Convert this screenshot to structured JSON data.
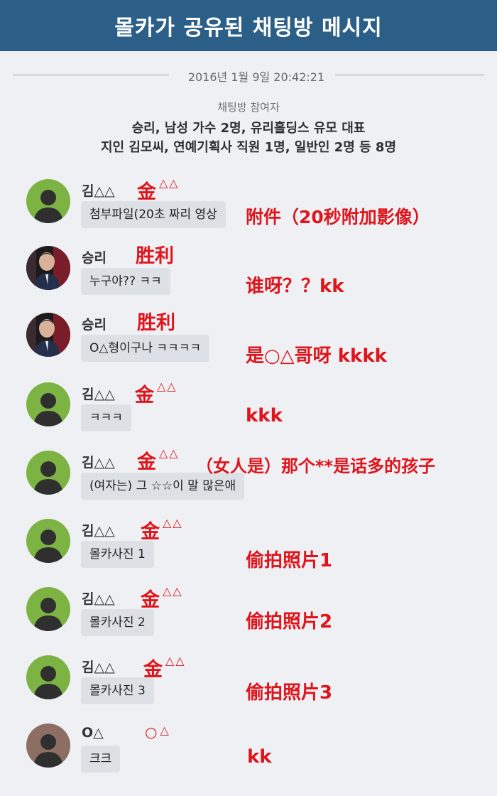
{
  "header": {
    "title": "몰카가 공유된 채팅방 메시지"
  },
  "timestamp": "2016년 1월 9일 20:42:21",
  "participants": {
    "label": "채팅방 참여자",
    "line1": "승리, 남성 가수 2명, 유리홀딩스 유모 대표",
    "line2": "지인 김모씨, 연예기획사 직원 1명, 일반인 2명 등 8명"
  },
  "messages": [
    {
      "sender": "김△△",
      "text": "첨부파일(20초 짜리 영상",
      "note_name": "金",
      "note_sym": "△△",
      "translation": "附件（20秒附加影像）",
      "avatar": "silhouette-green"
    },
    {
      "sender": "승리",
      "text": "누구야?? ㅋㅋ",
      "note_name": "胜利",
      "note_sym": "",
      "translation": "谁呀？？kk",
      "avatar": "photo"
    },
    {
      "sender": "승리",
      "text": "O△형이구나 ㅋㅋㅋㅋ",
      "note_name": "胜利",
      "note_sym": "",
      "translation": "是○△哥呀 kkkk",
      "avatar": "photo"
    },
    {
      "sender": "김△△",
      "text": "ㅋㅋㅋ",
      "note_name": "金",
      "note_sym": "△△",
      "translation": "kkk",
      "avatar": "silhouette-green"
    },
    {
      "sender": "김△△",
      "text": "(여자는) 그 ☆☆이 말 많은애",
      "note_name": "金",
      "note_sym": "△△",
      "translation": "（女人是）那个**是话多的孩子",
      "avatar": "silhouette-green"
    },
    {
      "sender": "김△△",
      "text": "몰카사진 1",
      "note_name": "金",
      "note_sym": "△△",
      "translation": "偷拍照片1",
      "avatar": "silhouette-green"
    },
    {
      "sender": "김△△",
      "text": "몰카사진 2",
      "note_name": "金",
      "note_sym": "△△",
      "translation": "偷拍照片2",
      "avatar": "silhouette-green"
    },
    {
      "sender": "김△△",
      "text": "몰카사진 3",
      "note_name": "金",
      "note_sym": "△△",
      "translation": "偷拍照片3",
      "avatar": "silhouette-green"
    },
    {
      "sender": "O△",
      "text": "크크",
      "note_name": "○",
      "note_sym": "△",
      "translation": "kk",
      "avatar": "silhouette-brown"
    }
  ],
  "colors": {
    "header_bg": "#2b5f88",
    "annotation": "#e0141b",
    "bubble_bg": "#dde1e6",
    "avatar_green": "#7cb342",
    "avatar_brown": "#8d6e63"
  }
}
